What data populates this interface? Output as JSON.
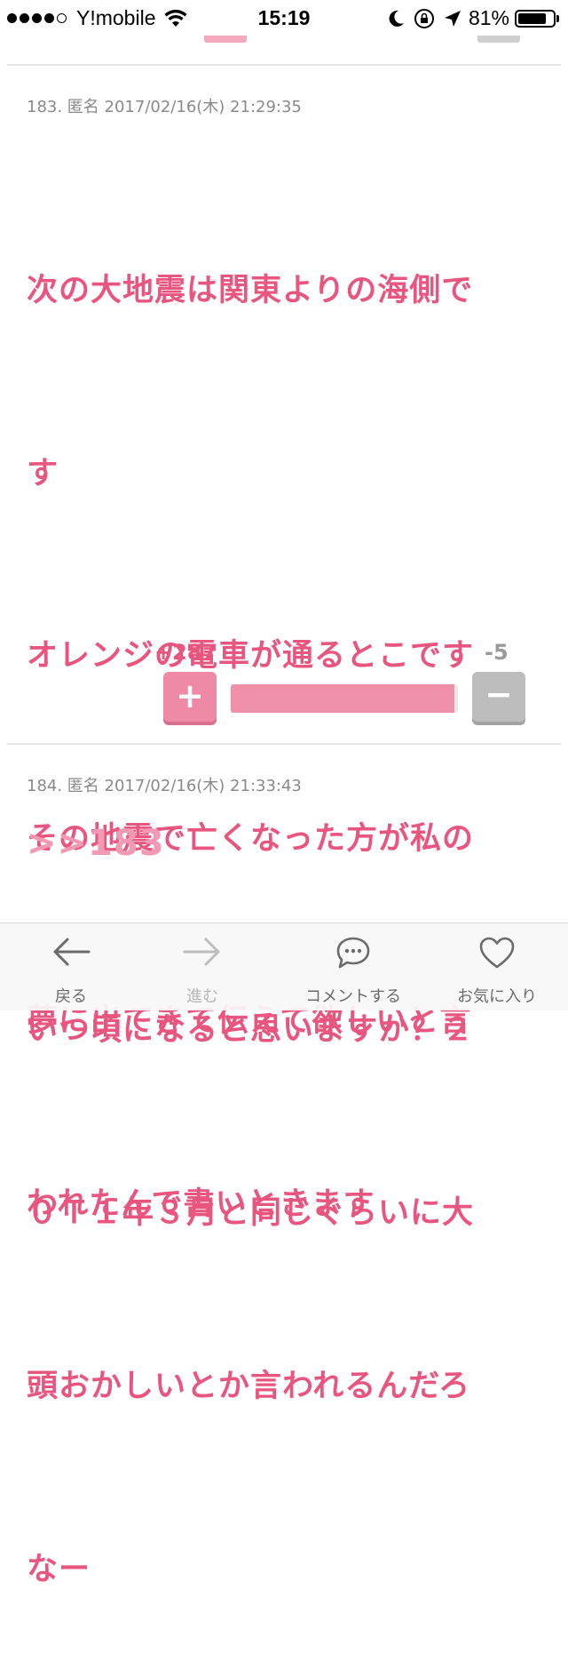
{
  "status_bar": {
    "carrier": "Y!mobile",
    "time": "15:19",
    "battery_percent": "81%",
    "battery_level": 0.81,
    "signal_dots_filled": 4,
    "signal_dots_total": 5
  },
  "comments": [
    {
      "meta": "183. 匿名 2017/02/16(木) 21:29:35",
      "lines": [
        "次の大地震は関東よりの海側で",
        "す",
        "オレンジの電車が通るとこです",
        "その地震で亡くなった方が私の",
        "夢に出てきて伝えて欲しいと言",
        "われたんで書いときます",
        "頭おかしいとか言われるんだろ",
        "なー"
      ],
      "plus_count": "+287",
      "minus_count": "-5",
      "plus_symbol": "+",
      "minus_symbol": "−",
      "vote_ratio": 0.983
    },
    {
      "meta": "184. 匿名 2017/02/16(木) 21:33:43",
      "reply": ">>183",
      "lines": [
        "いつ頃になると思いますか？２",
        "０Ｔ１年３月と同じぐらいに大"
      ]
    }
  ],
  "toolbar": {
    "back": "戻る",
    "forward": "進む",
    "comment": "コメントする",
    "favorite": "お気に入り"
  },
  "colors": {
    "accent": "#e8567f",
    "reply": "#f29ab3",
    "meta": "#8a8a8a"
  }
}
